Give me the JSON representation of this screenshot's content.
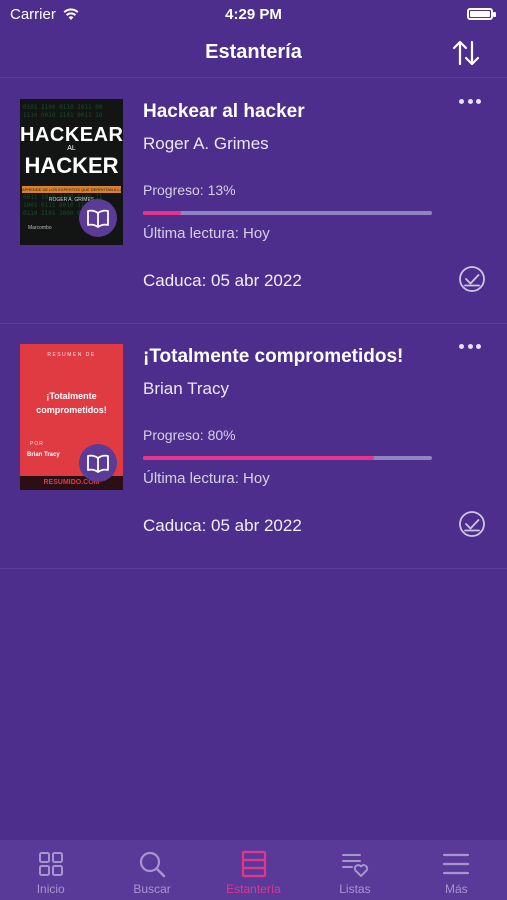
{
  "status_bar": {
    "carrier": "Carrier",
    "time": "4:29 PM"
  },
  "nav": {
    "title": "Estantería",
    "sort_icon": "sort-arrows-icon"
  },
  "books": [
    {
      "title": "Hackear al hacker",
      "author": "Roger A. Grimes",
      "progress_label": "Progreso: 13%",
      "progress": 0.13,
      "last_read": "Última lectura: Hoy",
      "expiry": "Caduca: 05 abr 2022",
      "cover": {
        "line1": "HACKEAR",
        "line2": "AL",
        "line3": "HACKER",
        "band": "APRENDE DE LOS EXPERTOS QUE DERROTAN A LOS HACKERS",
        "author": "ROGER A. GRIMES",
        "publisher": "Marcombo",
        "bg": "#121513",
        "accent": "#d9822b"
      }
    },
    {
      "title": "¡Totalmente comprometidos!",
      "author": "Brian Tracy",
      "progress_label": "Progreso: 80%",
      "progress": 0.8,
      "last_read": "Última lectura: Hoy",
      "expiry": "Caduca: 05 abr 2022",
      "cover": {
        "top": "RESUMEN DE",
        "line1": "¡Totalmente",
        "line2": "comprometidos!",
        "por": "POR",
        "author": "Brian Tracy",
        "footer": "RESUMIDO.COM",
        "bg": "#e03a43"
      }
    }
  ],
  "tabs": [
    {
      "label": "Inicio",
      "icon": "grid-icon",
      "active": false
    },
    {
      "label": "Buscar",
      "icon": "search-icon",
      "active": false
    },
    {
      "label": "Estantería",
      "icon": "shelf-icon",
      "active": true
    },
    {
      "label": "Listas",
      "icon": "list-heart-icon",
      "active": false
    },
    {
      "label": "Más",
      "icon": "menu-icon",
      "active": false
    }
  ],
  "colors": {
    "background": "#4e2e8c",
    "tab_bar": "#5a3a99",
    "accent": "#e4348d",
    "progress_track": "#9282be"
  }
}
